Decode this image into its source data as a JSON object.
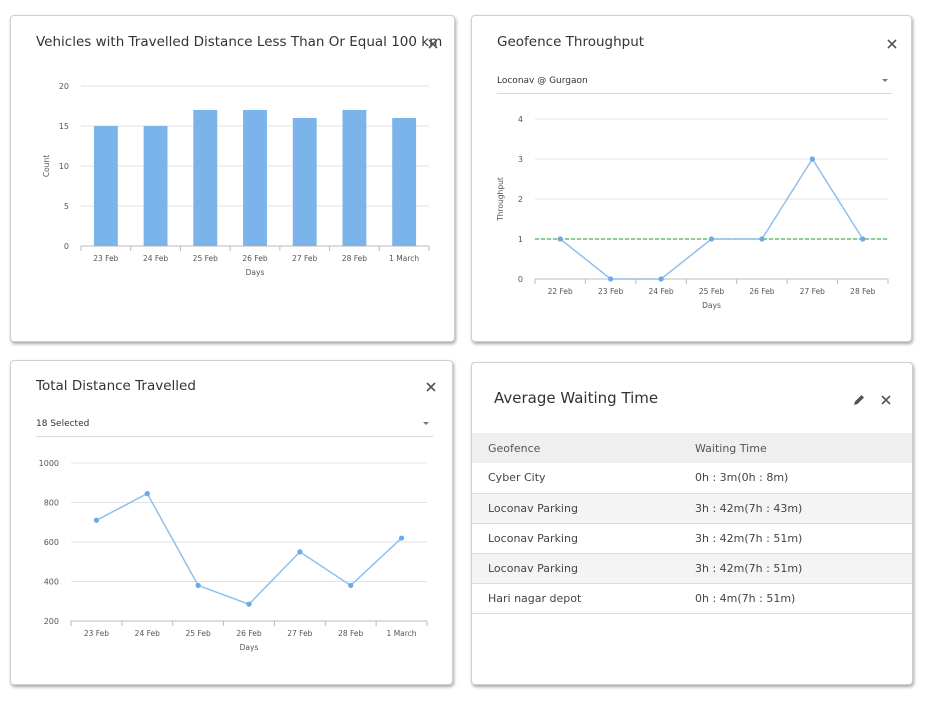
{
  "cards": {
    "vehicles": {
      "title": "Vehicles with Travelled Distance Less Than Or Equal 100 km"
    },
    "throughput": {
      "title": "Geofence Throughput",
      "select_value": "Loconav @ Gurgaon"
    },
    "distance": {
      "title": "Total Distance Travelled",
      "select_value": "18 Selected"
    },
    "waiting": {
      "title": "Average Waiting Time",
      "columns": [
        "Geofence",
        "Waiting Time"
      ],
      "rows": [
        [
          "Cyber City",
          "0h : 3m(0h : 8m)"
        ],
        [
          "Loconav Parking",
          "3h : 42m(7h : 43m)"
        ],
        [
          "Loconav Parking",
          "3h : 42m(7h : 51m)"
        ],
        [
          "Loconav Parking",
          "3h : 42m(7h : 51m)"
        ],
        [
          "Hari nagar depot",
          "0h : 4m(7h : 51m)"
        ]
      ]
    }
  },
  "icons": {
    "close": "close-icon",
    "edit": "pencil-icon",
    "dropdown": "caret-down-icon"
  },
  "colors": {
    "bar": "#7ab4ea",
    "line": "#8fc0ec",
    "marker": "#6aaae6",
    "threshold": "#4caf50"
  },
  "chart_data": [
    {
      "type": "bar",
      "title": "Vehicles with Travelled Distance Less Than Or Equal 100 km",
      "categories": [
        "23 Feb",
        "24 Feb",
        "25 Feb",
        "26 Feb",
        "27 Feb",
        "28 Feb",
        "1 March"
      ],
      "values": [
        15,
        15,
        17,
        17,
        16,
        17,
        16
      ],
      "xlabel": "Days",
      "ylabel": "Count",
      "ylim": [
        0,
        20
      ],
      "yticks": [
        0,
        5,
        10,
        15,
        20
      ],
      "grid": true
    },
    {
      "type": "line",
      "title": "Geofence Throughput",
      "categories": [
        "22 Feb",
        "23 Feb",
        "24 Feb",
        "25 Feb",
        "26 Feb",
        "27 Feb",
        "28 Feb"
      ],
      "values": [
        1,
        0,
        0,
        1,
        1,
        3,
        1
      ],
      "reference_line": 1,
      "xlabel": "Days",
      "ylabel": "Throughput",
      "ylim": [
        0,
        4
      ],
      "yticks": [
        0,
        1,
        2,
        3,
        4
      ],
      "grid": true
    },
    {
      "type": "line",
      "title": "Total Distance Travelled",
      "categories": [
        "23 Feb",
        "24 Feb",
        "25 Feb",
        "26 Feb",
        "27 Feb",
        "28 Feb",
        "1 March"
      ],
      "values": [
        710,
        845,
        380,
        285,
        550,
        380,
        620
      ],
      "xlabel": "Days",
      "ylabel": "",
      "ylim": [
        200,
        1000
      ],
      "yticks": [
        200,
        400,
        600,
        800,
        1000
      ],
      "grid": true
    }
  ]
}
